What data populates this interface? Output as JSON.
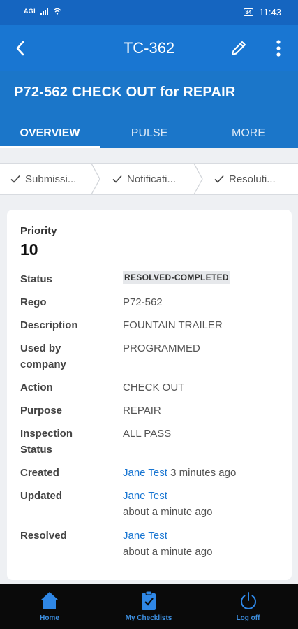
{
  "status_bar": {
    "carrier": "AGL",
    "signal_label": "4G",
    "battery": "84",
    "time": "11:43"
  },
  "app_bar": {
    "title": "TC-362"
  },
  "header": {
    "title": "P72-562 CHECK OUT for REPAIR",
    "tabs": [
      {
        "label": "OVERVIEW"
      },
      {
        "label": "PULSE"
      },
      {
        "label": "MORE"
      }
    ]
  },
  "steps": [
    {
      "label": "Submissi..."
    },
    {
      "label": "Notificati..."
    },
    {
      "label": "Resoluti..."
    }
  ],
  "details": {
    "priority_label": "Priority",
    "priority_value": "10",
    "status_label": "Status",
    "status_value": "RESOLVED-COMPLETED",
    "rego_label": "Rego",
    "rego_value": "P72-562",
    "description_label": "Description",
    "description_value": "FOUNTAIN TRAILER",
    "used_by_label_line1": "Used by",
    "used_by_label_line2": "company",
    "used_by_value": "PROGRAMMED",
    "action_label": "Action",
    "action_value": "CHECK OUT",
    "purpose_label": "Purpose",
    "purpose_value": "REPAIR",
    "inspection_label_line1": "Inspection",
    "inspection_label_line2": "Status",
    "inspection_value": "ALL PASS",
    "created_label": "Created",
    "created_user": "Jane Test",
    "created_time": "3 minutes ago",
    "updated_label": "Updated",
    "updated_user": "Jane Test",
    "updated_time": "about a minute ago",
    "resolved_label": "Resolved",
    "resolved_user": "Jane Test",
    "resolved_time": "about a minute ago"
  },
  "bottom_nav": [
    {
      "label": "Home",
      "icon": "home-icon"
    },
    {
      "label": "My Checklists",
      "icon": "clipboard-icon"
    },
    {
      "label": "Log off",
      "icon": "power-icon"
    }
  ],
  "colors": {
    "primary": "#1976d2",
    "status_bar": "#1565c0",
    "link": "#1976d2",
    "nav_accent": "#3d8fe0"
  }
}
